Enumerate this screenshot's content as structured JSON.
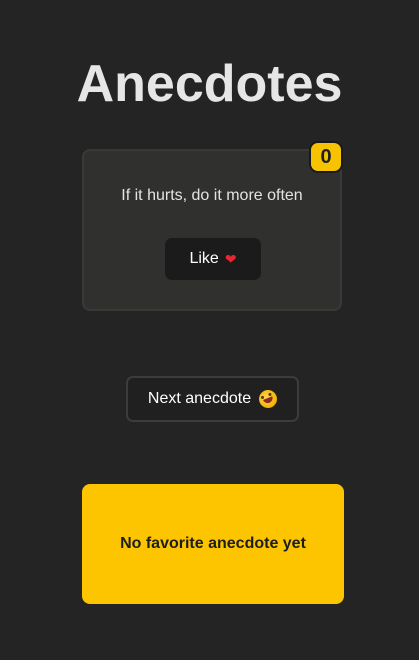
{
  "page": {
    "title": "Anecdotes"
  },
  "anecdote_card": {
    "text": "If it hurts, do it more often",
    "like_label": "Like",
    "like_icon": "heart-icon",
    "vote_count": "0"
  },
  "next_button": {
    "label": "Next anecdote",
    "icon": "rolling-on-floor-laughing-icon"
  },
  "favorite": {
    "text": "No favorite anecdote yet"
  },
  "colors": {
    "background": "#242424",
    "card": "#30312f",
    "accent_yellow": "#fdc500",
    "heart": "#e7262f"
  }
}
